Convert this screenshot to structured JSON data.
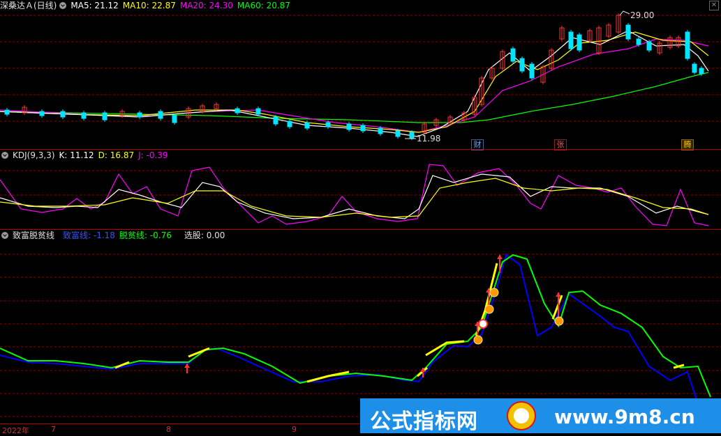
{
  "main_panel": {
    "title": "深桑达Ａ(日线)",
    "indicators": [
      {
        "label": "MA5: 21.12",
        "color": "#ffffff"
      },
      {
        "label": "MA10: 22.87",
        "color": "#ffff00"
      },
      {
        "label": "MA20: 24.30",
        "color": "#ff00ff"
      },
      {
        "label": "MA60: 20.87",
        "color": "#00ff00"
      }
    ],
    "high_label": "29.00",
    "low_label": "11.98",
    "badges": [
      {
        "text": "财",
        "color": "#3a7bd5"
      },
      {
        "text": "张",
        "color": "#ff3333"
      },
      {
        "text": "腾",
        "color": "#ffcc00"
      }
    ]
  },
  "kdj_panel": {
    "title": "KDJ(9,3,3)",
    "k": "K: 11.12",
    "d": "D: 16.87",
    "j": "J: -0.39"
  },
  "indicator_panel": {
    "title": "致富脱贫线",
    "line1": "致富线: -1.18",
    "line2": "脱贫线: -0.76",
    "select": "选股: 0.00"
  },
  "x_axis": {
    "labels": [
      "2022年",
      "7",
      "8",
      "9"
    ]
  },
  "watermark": {
    "left": "公式指标网",
    "right": "www.9m8.cn"
  },
  "close_icon": "✕",
  "colors": {
    "up": "#ff3333",
    "down": "#00e5ff",
    "ma5": "#ffffff",
    "ma10": "#ffff00",
    "ma20": "#ff00ff",
    "ma60": "#00ff00",
    "grid": "#8b0000",
    "blue_line": "#0000ff",
    "green_line": "#00ff00"
  }
}
